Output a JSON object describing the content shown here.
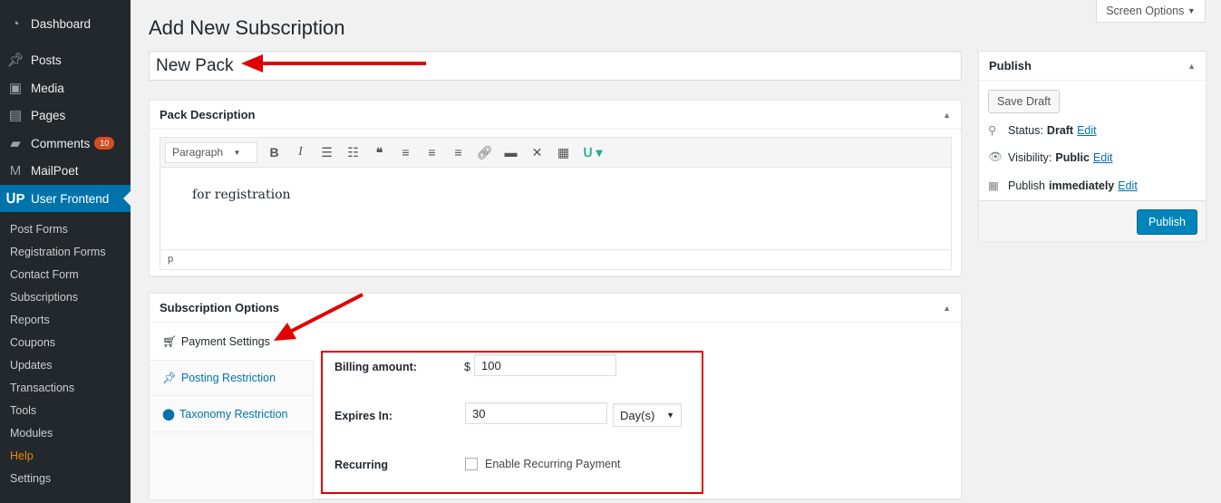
{
  "sidebar": {
    "menu": [
      {
        "label": "Dashboard",
        "icon": "dashboard-icon"
      },
      {
        "label": "Posts",
        "icon": "pin-icon"
      },
      {
        "label": "Media",
        "icon": "media-icon"
      },
      {
        "label": "Pages",
        "icon": "pages-icon"
      },
      {
        "label": "Comments",
        "icon": "comment-icon",
        "badge": "10"
      },
      {
        "label": "MailPoet",
        "icon": "mailpoet-icon"
      },
      {
        "label": "User Frontend",
        "icon": "user-frontend-icon"
      }
    ],
    "submenu": [
      "Post Forms",
      "Registration Forms",
      "Contact Form",
      "Subscriptions",
      "Reports",
      "Coupons",
      "Updates",
      "Transactions",
      "Tools",
      "Modules",
      "Help",
      "Settings"
    ]
  },
  "header": {
    "title": "Add New Subscription",
    "screen_options": "Screen Options"
  },
  "title_input": {
    "value": "New Pack"
  },
  "description": {
    "heading": "Pack Description",
    "format": "Paragraph",
    "content": "for registration",
    "path": "p"
  },
  "options": {
    "heading": "Subscription Options",
    "tabs": [
      "Payment Settings",
      "Posting Restriction",
      "Taxonomy Restriction"
    ],
    "billing_label": "Billing amount:",
    "currency": "$",
    "billing_value": "100",
    "expires_label": "Expires In:",
    "expires_value": "30",
    "expires_unit": "Day(s)",
    "recurring_label": "Recurring",
    "recurring_checkbox": "Enable Recurring Payment",
    "recurring_checked": false
  },
  "publish": {
    "heading": "Publish",
    "save_draft": "Save Draft",
    "status_label": "Status:",
    "status": "Draft",
    "visibility_label": "Visibility:",
    "visibility": "Public",
    "publish_label": "Publish",
    "publish_when": "immediately",
    "edit": "Edit",
    "publish_button": "Publish"
  },
  "colors": {
    "accent": "#0073aa",
    "annotation": "#e00000",
    "sidebar": "#23282d"
  }
}
